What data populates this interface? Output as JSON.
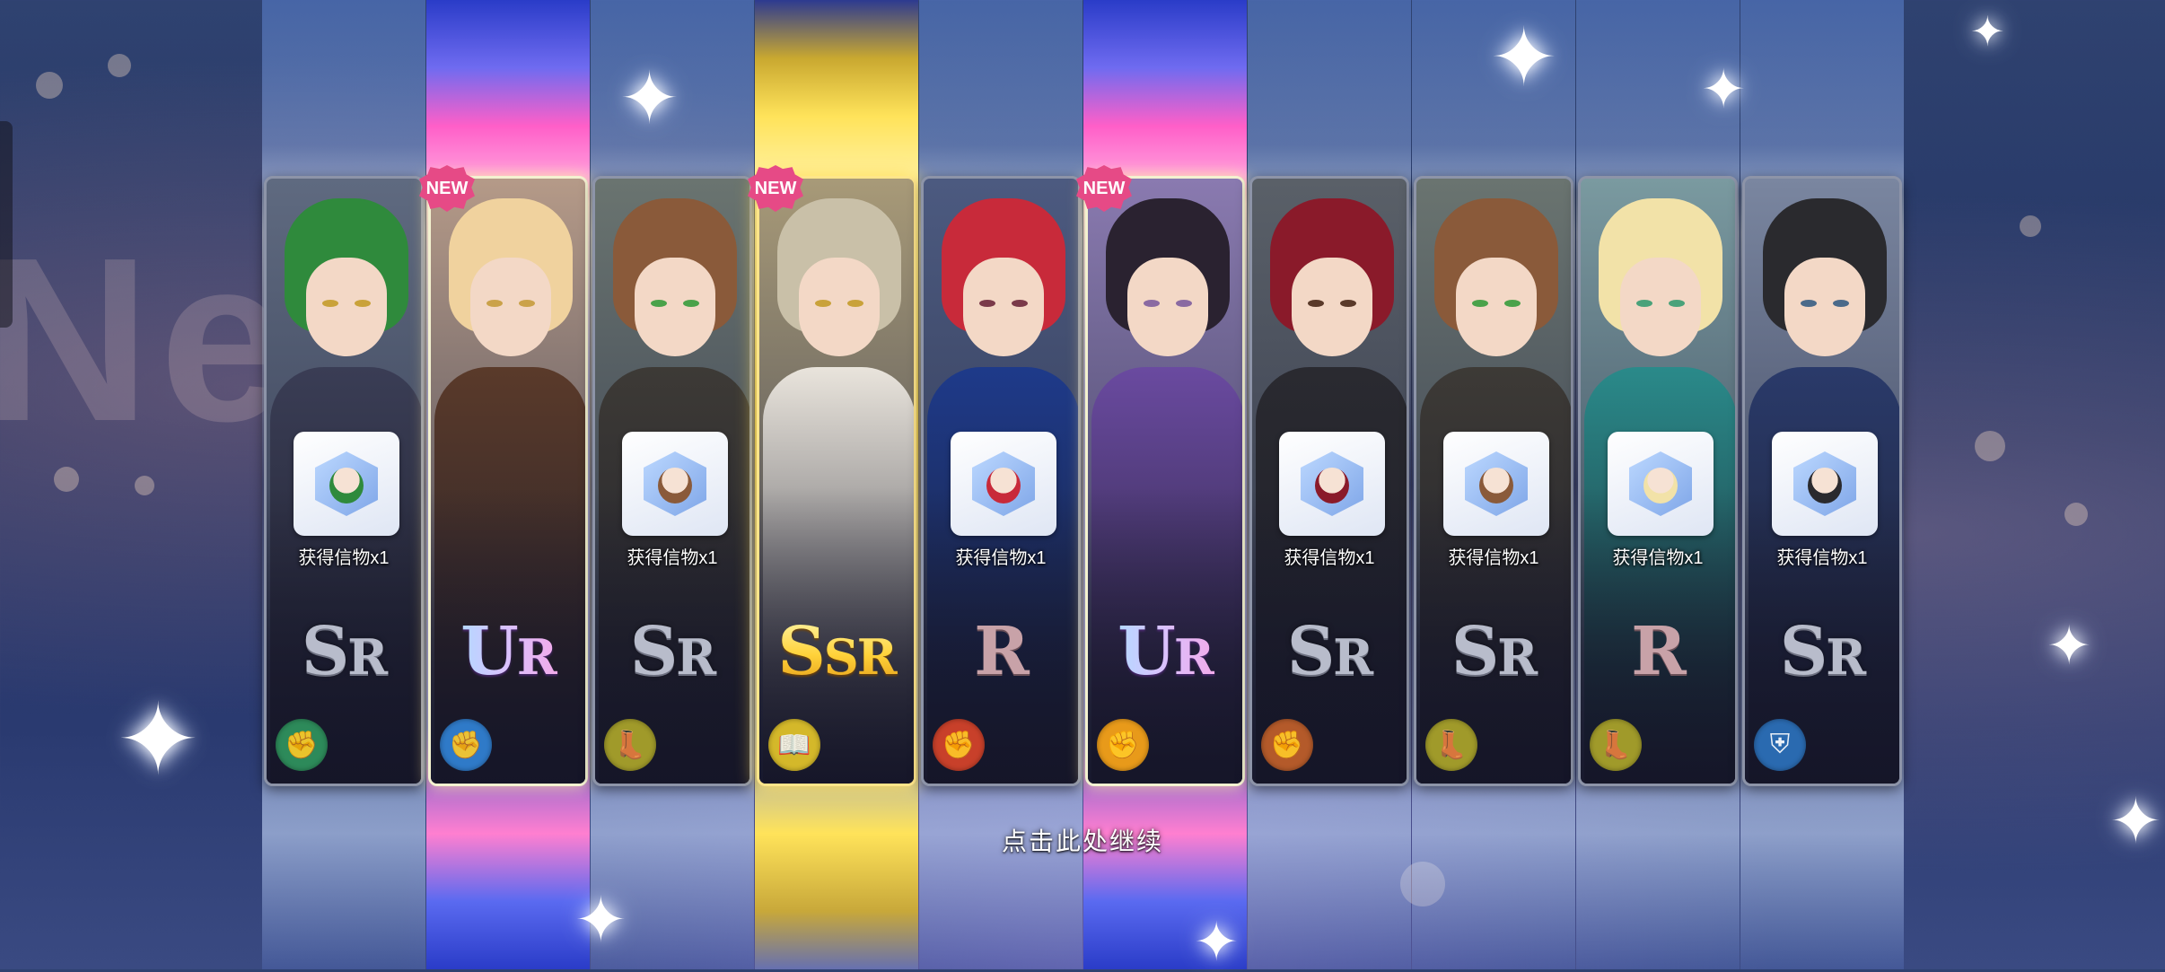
{
  "background": {
    "text": "Ne"
  },
  "continue_label": "点击此处继续",
  "new_label": "NEW",
  "cards": [
    {
      "token_label": "获得信物x1",
      "rarity": [
        "S",
        "R"
      ],
      "rarity_class": "sr",
      "type_icon": "fist-icon",
      "type_color": "#2d8a5a",
      "hair": "#2f8a3c",
      "eye": "#c9a23a",
      "outfit": "#3a3d55",
      "bg": "#5f6a80",
      "beam": "normal",
      "is_new": false
    },
    {
      "token_label": "",
      "rarity": [
        "U",
        "R"
      ],
      "rarity_class": "ur",
      "type_icon": "fist-icon",
      "type_color": "#2f7ac8",
      "hair": "#f0d29e",
      "eye": "#caa24a",
      "outfit": "#5a3a2a",
      "bg": "#b59a88",
      "beam": "ur",
      "is_new": true
    },
    {
      "token_label": "获得信物x1",
      "rarity": [
        "S",
        "R"
      ],
      "rarity_class": "sr",
      "type_icon": "boot-icon",
      "type_color": "#a09a2a",
      "hair": "#8a5a3a",
      "eye": "#4aa24a",
      "outfit": "#3d3a36",
      "bg": "#6a7470",
      "beam": "normal",
      "is_new": false
    },
    {
      "token_label": "",
      "rarity": [
        "S",
        "S",
        "R"
      ],
      "rarity_class": "ssr",
      "type_icon": "book-icon",
      "type_color": "#d4b82a",
      "hair": "#c9c0a8",
      "eye": "#c9a23a",
      "outfit": "#e9e4dc",
      "bg": "#a89a78",
      "beam": "ssr",
      "is_new": true
    },
    {
      "token_label": "获得信物x1",
      "rarity": [
        "R"
      ],
      "rarity_class": "r",
      "type_icon": "fist-icon",
      "type_color": "#c8402a",
      "hair": "#c82a3a",
      "eye": "#7a3a4a",
      "outfit": "#1e3a8a",
      "bg": "#4c5a80",
      "beam": "normal",
      "is_new": false
    },
    {
      "token_label": "",
      "rarity": [
        "U",
        "R"
      ],
      "rarity_class": "ur",
      "type_icon": "fist-icon",
      "type_color": "#e89a1a",
      "hair": "#2a2230",
      "eye": "#8a6aa2",
      "outfit": "#6a4aa0",
      "bg": "#8a7ab0",
      "beam": "ur",
      "is_new": true
    },
    {
      "token_label": "获得信物x1",
      "rarity": [
        "S",
        "R"
      ],
      "rarity_class": "sr",
      "type_icon": "fist-icon",
      "type_color": "#b45a2a",
      "hair": "#8a1a2a",
      "eye": "#5a3a2a",
      "outfit": "#2a2a30",
      "bg": "#5a6068",
      "beam": "normal",
      "is_new": false
    },
    {
      "token_label": "获得信物x1",
      "rarity": [
        "S",
        "R"
      ],
      "rarity_class": "sr",
      "type_icon": "boot-icon",
      "type_color": "#a09a2a",
      "hair": "#8a5a3a",
      "eye": "#4aa24a",
      "outfit": "#3d3a36",
      "bg": "#6a7470",
      "beam": "normal",
      "is_new": false
    },
    {
      "token_label": "获得信物x1",
      "rarity": [
        "R"
      ],
      "rarity_class": "r",
      "type_icon": "boot-icon",
      "type_color": "#a09a2a",
      "hair": "#f2e2a8",
      "eye": "#4aa27a",
      "outfit": "#2a8a8a",
      "bg": "#7a9aa0",
      "beam": "normal",
      "is_new": false
    },
    {
      "token_label": "获得信物x1",
      "rarity": [
        "S",
        "R"
      ],
      "rarity_class": "sr",
      "type_icon": "shield-icon",
      "type_color": "#2a6ab0",
      "hair": "#2a2a2e",
      "eye": "#4a6a8a",
      "outfit": "#2a3a6a",
      "bg": "#7a86a0",
      "beam": "normal",
      "is_new": false
    }
  ]
}
